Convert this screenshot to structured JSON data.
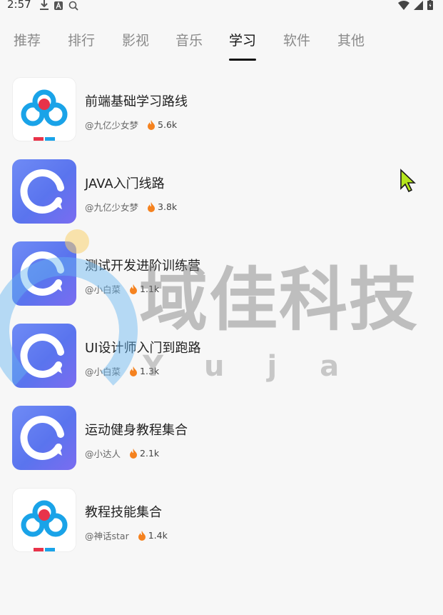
{
  "status_bar": {
    "time": "2:57"
  },
  "tabs": [
    {
      "label": "推荐",
      "active": false
    },
    {
      "label": "排行",
      "active": false
    },
    {
      "label": "影视",
      "active": false
    },
    {
      "label": "音乐",
      "active": false
    },
    {
      "label": "学习",
      "active": true
    },
    {
      "label": "软件",
      "active": false
    },
    {
      "label": "其他",
      "active": false
    }
  ],
  "items": [
    {
      "title": "前端基础学习路线",
      "author": "@九亿少女梦",
      "hot": "5.6k",
      "icon": "cloud-logo-icon"
    },
    {
      "title": "JAVA入门线路",
      "author": "@九亿少女梦",
      "hot": "3.8k",
      "icon": "ring-logo-icon"
    },
    {
      "title": "测试开发进阶训练营",
      "author": "@小白菜",
      "hot": "1.1k",
      "icon": "ring-logo-icon"
    },
    {
      "title": "UI设计师入门到跑路",
      "author": "@小白菜",
      "hot": "1.3k",
      "icon": "ring-logo-icon"
    },
    {
      "title": "运动健身教程集合",
      "author": "@小达人",
      "hot": "2.1k",
      "icon": "ring-logo-icon"
    },
    {
      "title": "教程技能集合",
      "author": "@神话star",
      "hot": "1.4k",
      "icon": "cloud-logo-icon"
    }
  ],
  "watermark": {
    "text": "域佳科技",
    "sub": "Yuja"
  },
  "colors": {
    "accent": "#111111",
    "ring_gradient_start": "#6f8bf5",
    "ring_gradient_end": "#7a6cf0",
    "fire": "#f5821f"
  }
}
